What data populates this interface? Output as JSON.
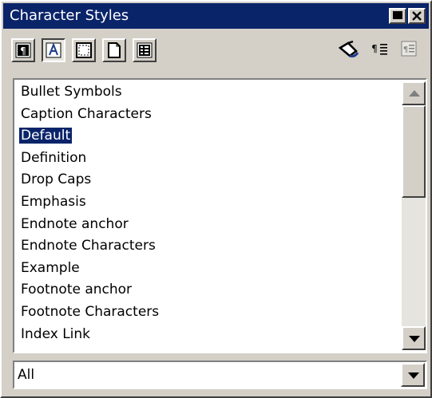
{
  "window": {
    "title": "Character Styles"
  },
  "toolbar": {
    "style_families": [
      {
        "icon": "paragraph-styles-icon"
      },
      {
        "icon": "character-styles-icon",
        "selected": true
      },
      {
        "icon": "frame-styles-icon"
      },
      {
        "icon": "page-styles-icon"
      },
      {
        "icon": "list-styles-icon"
      }
    ],
    "actions": [
      {
        "icon": "fill-format-mode-icon"
      },
      {
        "icon": "new-style-from-selection-icon"
      },
      {
        "icon": "update-style-icon"
      }
    ],
    "paragraph_glyph": "¶"
  },
  "styles_list": {
    "items": [
      "Bullet Symbols",
      "Caption Characters",
      "Default",
      "Definition",
      "Drop Caps",
      "Emphasis",
      "Endnote anchor",
      "Endnote Characters",
      "Example",
      "Footnote anchor",
      "Footnote Characters",
      "Index Link"
    ],
    "selected_index": 2
  },
  "filter": {
    "value": "All"
  },
  "colors": {
    "titlebar": "#0a246a",
    "selection": "#0a246a",
    "face": "#d4d0c8"
  }
}
